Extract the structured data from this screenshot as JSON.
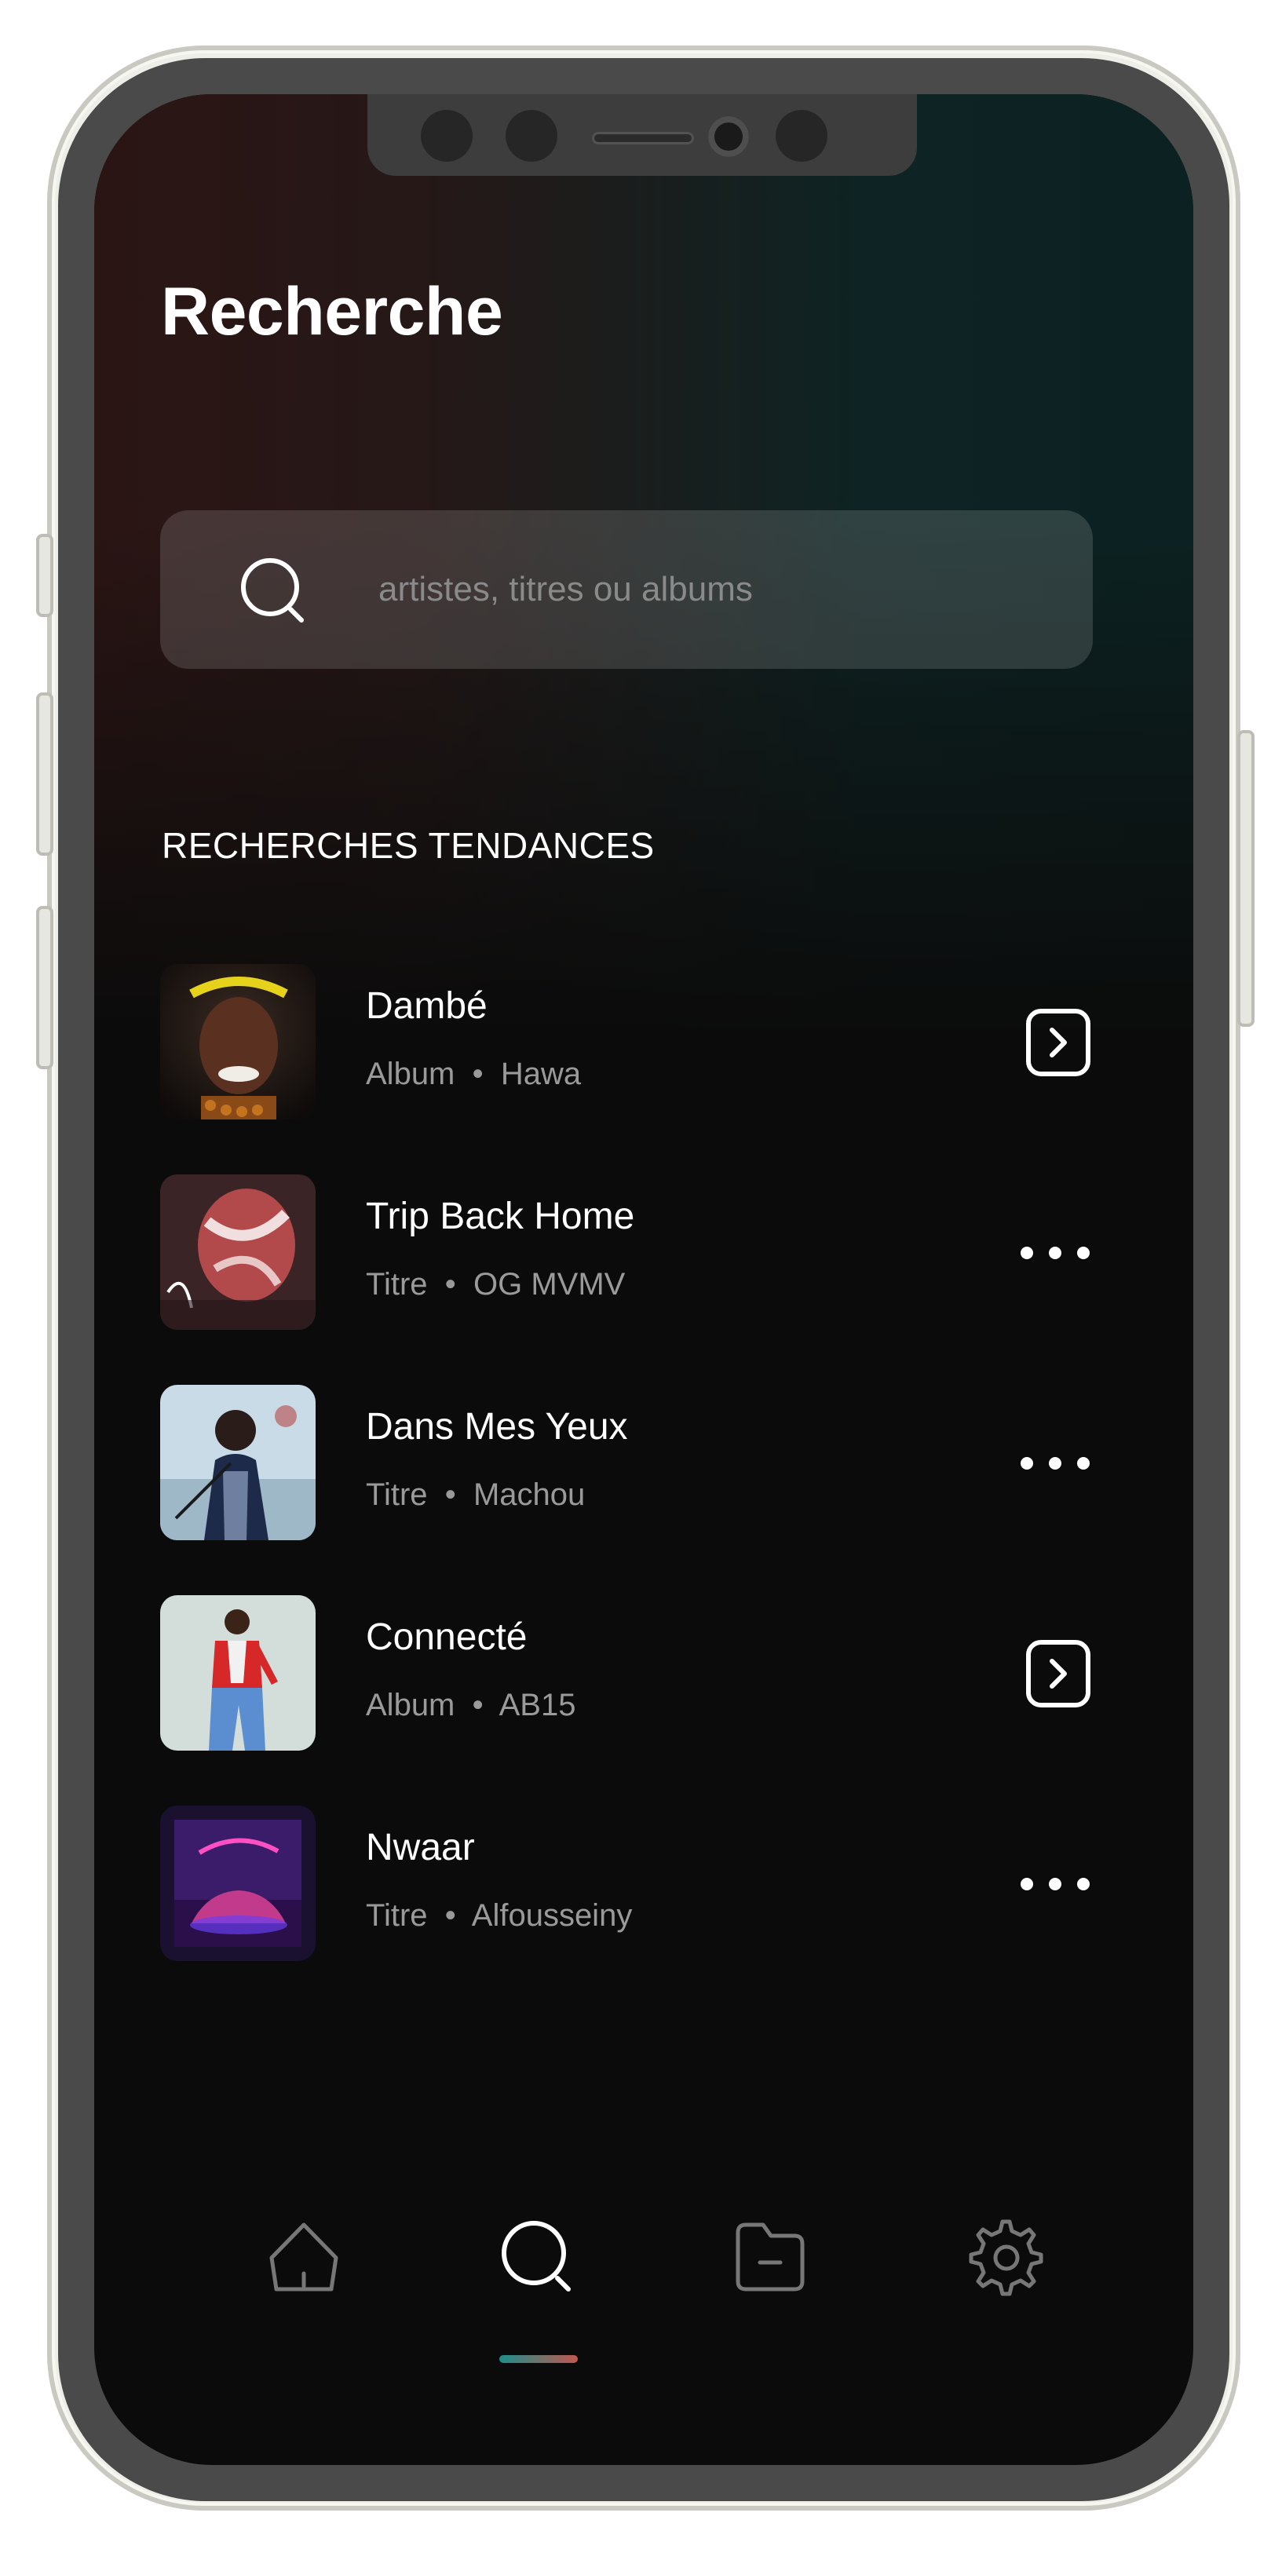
{
  "app": {
    "title": "Recherche"
  },
  "search": {
    "placeholder": "artistes, titres ou albums",
    "icon": "search-icon"
  },
  "trending": {
    "heading": "RECHERCHES TENDANCES",
    "items": [
      {
        "title": "Dambé",
        "type": "Album",
        "artist": "Hawa",
        "subtitle": "Album  •  Hawa",
        "action": "chevron-right-box-icon"
      },
      {
        "title": "Trip Back Home",
        "type": "Titre",
        "artist": "OG MVMV",
        "subtitle": "Titre  •  OG MVMV",
        "action": "more-options-icon"
      },
      {
        "title": "Dans Mes Yeux",
        "type": "Titre",
        "artist": "Machou",
        "subtitle": "Titre  •  Machou",
        "action": "more-options-icon"
      },
      {
        "title": "Connecté",
        "type": "Album",
        "artist": "AB15",
        "subtitle": "Album  •  AB15",
        "action": "chevron-right-box-icon"
      },
      {
        "title": "Nwaar",
        "type": "Titre",
        "artist": "Alfousseiny",
        "subtitle": "Titre  •  Alfousseiny",
        "action": "more-options-icon"
      }
    ]
  },
  "tabbar": {
    "tabs": [
      {
        "icon": "home-icon",
        "active": false
      },
      {
        "icon": "search-icon",
        "active": true
      },
      {
        "icon": "folder-icon",
        "active": false
      },
      {
        "icon": "settings-gear-icon",
        "active": false
      }
    ]
  },
  "colors": {
    "background": "#0b0b0b",
    "text": "#ffffff",
    "subtext": "#9a9a9a",
    "accent_start": "#1d8f8a",
    "accent_end": "#c0574f"
  }
}
